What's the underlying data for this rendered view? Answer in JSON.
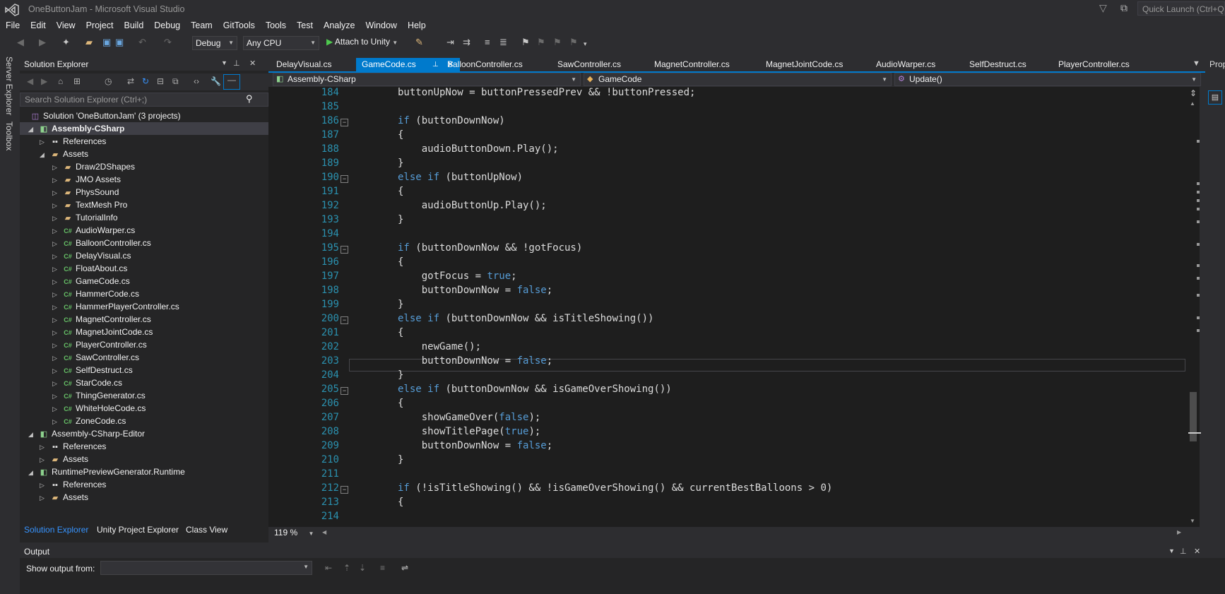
{
  "window": {
    "title": "OneButtonJam - Microsoft Visual Studio",
    "quick_launch_placeholder": "Quick Launch (Ctrl+Q)"
  },
  "menu": [
    "File",
    "Edit",
    "View",
    "Project",
    "Build",
    "Debug",
    "Team",
    "GitTools",
    "Tools",
    "Test",
    "Analyze",
    "Window",
    "Help"
  ],
  "toolbar": {
    "config": "Debug",
    "platform": "Any CPU",
    "attach_label": "Attach to Unity"
  },
  "side_tabs": {
    "server_explorer": "Server Explorer",
    "toolbox": "Toolbox"
  },
  "solution_explorer": {
    "title": "Solution Explorer",
    "search_placeholder": "Search Solution Explorer (Ctrl+;)",
    "tree": [
      {
        "label": "Solution 'OneButtonJam' (3 projects)",
        "icon": "solution-icon"
      },
      {
        "label": "Assembly-CSharp",
        "icon": "project-icon",
        "bold": true
      },
      {
        "label": "References",
        "icon": "references-icon"
      },
      {
        "label": "Assets",
        "icon": "folder-icon"
      },
      {
        "label": "Draw2DShapes",
        "icon": "folder-icon"
      },
      {
        "label": "JMO Assets",
        "icon": "folder-icon"
      },
      {
        "label": "PhysSound",
        "icon": "folder-icon"
      },
      {
        "label": "TextMesh Pro",
        "icon": "folder-icon"
      },
      {
        "label": "TutorialInfo",
        "icon": "folder-icon"
      },
      {
        "label": "AudioWarper.cs",
        "icon": "csharp-file-icon"
      },
      {
        "label": "BalloonController.cs",
        "icon": "csharp-file-icon"
      },
      {
        "label": "DelayVisual.cs",
        "icon": "csharp-file-icon"
      },
      {
        "label": "FloatAbout.cs",
        "icon": "csharp-file-icon"
      },
      {
        "label": "GameCode.cs",
        "icon": "csharp-file-icon"
      },
      {
        "label": "HammerCode.cs",
        "icon": "csharp-file-icon"
      },
      {
        "label": "HammerPlayerController.cs",
        "icon": "csharp-file-icon"
      },
      {
        "label": "MagnetController.cs",
        "icon": "csharp-file-icon"
      },
      {
        "label": "MagnetJointCode.cs",
        "icon": "csharp-file-icon"
      },
      {
        "label": "PlayerController.cs",
        "icon": "csharp-file-icon"
      },
      {
        "label": "SawController.cs",
        "icon": "csharp-file-icon"
      },
      {
        "label": "SelfDestruct.cs",
        "icon": "csharp-file-icon"
      },
      {
        "label": "StarCode.cs",
        "icon": "csharp-file-icon"
      },
      {
        "label": "ThingGenerator.cs",
        "icon": "csharp-file-icon"
      },
      {
        "label": "WhiteHoleCode.cs",
        "icon": "csharp-file-icon"
      },
      {
        "label": "ZoneCode.cs",
        "icon": "csharp-file-icon"
      },
      {
        "label": "Assembly-CSharp-Editor",
        "icon": "project-icon"
      },
      {
        "label": "References",
        "icon": "references-icon"
      },
      {
        "label": "Assets",
        "icon": "folder-icon"
      },
      {
        "label": "RuntimePreviewGenerator.Runtime",
        "icon": "project-icon"
      },
      {
        "label": "References",
        "icon": "references-icon"
      },
      {
        "label": "Assets",
        "icon": "folder-icon"
      }
    ],
    "bottom_tabs": [
      "Solution Explorer",
      "Unity Project Explorer",
      "Class View"
    ]
  },
  "editor": {
    "tabs": [
      "DelayVisual.cs",
      "GameCode.cs",
      "BalloonController.cs",
      "SawController.cs",
      "MagnetController.cs",
      "MagnetJointCode.cs",
      "AudioWarper.cs",
      "SelfDestruct.cs",
      "PlayerController.cs"
    ],
    "active_tab": "GameCode.cs",
    "nav": {
      "project": "Assembly-CSharp",
      "type": "GameCode",
      "member": "Update()"
    },
    "zoom": "119 %",
    "lines": [
      {
        "n": "184",
        "code": "buttonUpNow = buttonPressedPrev && !buttonPressed;"
      },
      {
        "n": "185",
        "code": ""
      },
      {
        "n": "186",
        "code": "if (buttonDownNow)"
      },
      {
        "n": "187",
        "code": "{"
      },
      {
        "n": "188",
        "code": "    audioButtonDown.Play();"
      },
      {
        "n": "189",
        "code": "}"
      },
      {
        "n": "190",
        "code": "else if (buttonUpNow)"
      },
      {
        "n": "191",
        "code": "{"
      },
      {
        "n": "192",
        "code": "    audioButtonUp.Play();"
      },
      {
        "n": "193",
        "code": "}"
      },
      {
        "n": "194",
        "code": ""
      },
      {
        "n": "195",
        "code": "if (buttonDownNow && !gotFocus)"
      },
      {
        "n": "196",
        "code": "{"
      },
      {
        "n": "197",
        "code": "    gotFocus = true;"
      },
      {
        "n": "198",
        "code": "    buttonDownNow = false;"
      },
      {
        "n": "199",
        "code": "}"
      },
      {
        "n": "200",
        "code": "else if (buttonDownNow && isTitleShowing())"
      },
      {
        "n": "201",
        "code": "{"
      },
      {
        "n": "202",
        "code": "    newGame();"
      },
      {
        "n": "203",
        "code": "    buttonDownNow = false;"
      },
      {
        "n": "204",
        "code": "}"
      },
      {
        "n": "205",
        "code": "else if (buttonDownNow && isGameOverShowing())"
      },
      {
        "n": "206",
        "code": "{"
      },
      {
        "n": "207",
        "code": "    showGameOver(false);"
      },
      {
        "n": "208",
        "code": "    showTitlePage(true);"
      },
      {
        "n": "209",
        "code": "    buttonDownNow = false;"
      },
      {
        "n": "210",
        "code": "}"
      },
      {
        "n": "211",
        "code": ""
      },
      {
        "n": "212",
        "code": "if (!isTitleShowing() && !isGameOverShowing() && currentBestBalloons > 0)"
      },
      {
        "n": "213",
        "code": "{"
      },
      {
        "n": "214",
        "code": ""
      }
    ]
  },
  "right_panel": {
    "label": "Prop"
  },
  "output": {
    "title": "Output",
    "show_from_label": "Show output from:",
    "show_from_value": ""
  },
  "colors": {
    "accent": "#007acc",
    "keyword": "#569cd6",
    "line_number": "#2b91af",
    "text": "#dcdcdc"
  }
}
